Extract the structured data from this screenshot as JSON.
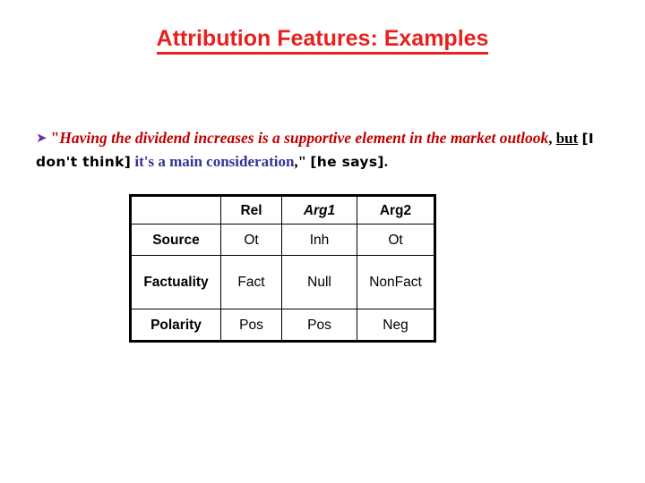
{
  "slide": {
    "title": "Attribution Features: Examples",
    "background_color": "#ffffff",
    "title_color": "#e8201f"
  },
  "example": {
    "bullet_icon": "arrow-bullet",
    "bullet_glyph": "➤",
    "bullet_color": "#7030a0",
    "segments": [
      {
        "text": "\"",
        "style": "red-quote"
      },
      {
        "text": "Having the dividend increases is a supportive element in the market outlook",
        "style": "red-italic"
      },
      {
        "text": ", ",
        "style": "black-plain"
      },
      {
        "text": "but",
        "style": "black-underline"
      },
      {
        "text": " ",
        "style": "black-plain"
      },
      {
        "text": "[I don't think]",
        "style": "comic-bold"
      },
      {
        "text": " ",
        "style": "black-plain"
      },
      {
        "text": "it's a main consideration",
        "style": "blue-serif"
      },
      {
        "text": ",\" ",
        "style": "black-plain"
      },
      {
        "text": "[he says]",
        "style": "comic-bold"
      },
      {
        "text": ".",
        "style": "black-plain"
      }
    ],
    "line1_text": "❝ Having the dividend increases is a supportive element in the market",
    "line2_text": "outlook, but [I don't think] it's a main consideration,\" [he says]."
  },
  "table": {
    "headers": [
      "",
      "Rel",
      "Arg1",
      "Arg2"
    ],
    "header_colors": [
      "#000000",
      "#000000",
      "#cc0000",
      "#333399"
    ],
    "rows": [
      {
        "label": "Source",
        "values": [
          "Ot",
          "Inh",
          "Ot"
        ]
      },
      {
        "label": "Factuality",
        "values": [
          "Fact",
          "Null",
          "NonFact"
        ]
      },
      {
        "label": "Polarity",
        "values": [
          "Pos",
          "Pos",
          "Neg"
        ]
      }
    ]
  }
}
